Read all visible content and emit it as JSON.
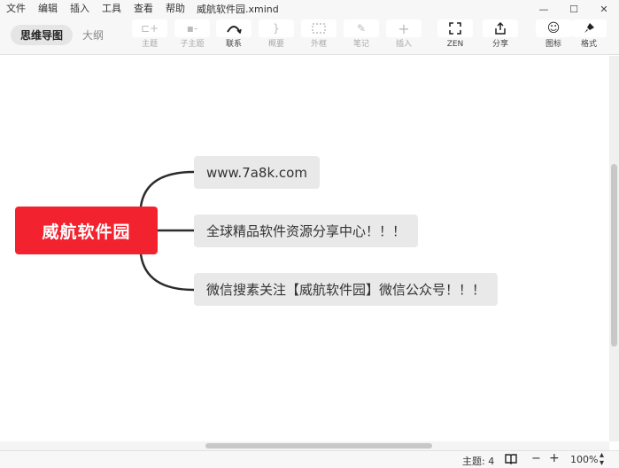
{
  "menubar": {
    "items": [
      "文件",
      "编辑",
      "插入",
      "工具",
      "查看",
      "帮助"
    ],
    "file_title": "威航软件园.xmind"
  },
  "window_controls": {
    "minimize": "—",
    "maximize": "☐",
    "close": "✕"
  },
  "view_switch": {
    "mindmap": "思维导图",
    "outline": "大纲"
  },
  "toolbar": {
    "topic": "主题",
    "subtopic": "子主题",
    "relationship": "联系",
    "summary": "概要",
    "boundary": "外框",
    "note": "笔记",
    "insert": "插入",
    "zen": "ZEN",
    "share": "分享",
    "icons": "图标",
    "format": "格式"
  },
  "mindmap": {
    "central": "威航软件园",
    "subtopics": [
      "www.7a8k.com",
      "全球精品软件资源分享中心！！！",
      "微信搜素关注【威航软件园】微信公众号！！！"
    ]
  },
  "statusbar": {
    "topic_count": "主题: 4",
    "zoom": "100%"
  },
  "colors": {
    "central_topic": "#f2232f",
    "subtopic": "#e9e9e9",
    "connector": "#2b2b2b"
  }
}
